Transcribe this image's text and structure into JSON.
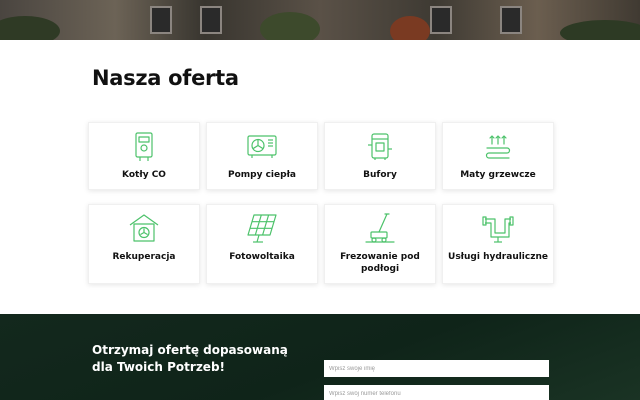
{
  "offer": {
    "title": "Nasza oferta",
    "items": [
      {
        "label": "Kotły CO",
        "icon": "boiler-icon"
      },
      {
        "label": "Pompy ciepła",
        "icon": "heat-pump-icon"
      },
      {
        "label": "Bufory",
        "icon": "buffer-tank-icon"
      },
      {
        "label": "Maty grzewcze",
        "icon": "heating-mat-icon"
      },
      {
        "label": "Rekuperacja",
        "icon": "recuperation-icon"
      },
      {
        "label": "Fotowoltaika",
        "icon": "solar-panel-icon"
      },
      {
        "label": "Frezowanie pod podłogi",
        "icon": "floor-milling-icon"
      },
      {
        "label": "Usługi hydrauliczne",
        "icon": "plumbing-pipe-icon"
      }
    ]
  },
  "cta": {
    "title": "Otrzymaj ofertę dopasowaną dla Twoich Potrzeb!",
    "name_placeholder": "Wpisz swoje imię",
    "phone_placeholder": "Wpisz swój numer telefonu"
  },
  "colors": {
    "accent_green": "#4cc26a",
    "cta_background": "#13281d",
    "text_dark": "#111111"
  }
}
